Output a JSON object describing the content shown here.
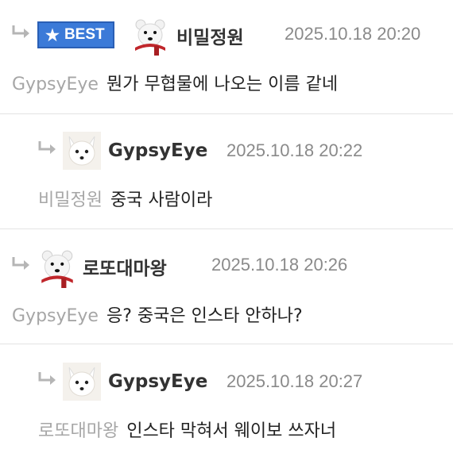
{
  "comments": [
    {
      "best_label": "BEST",
      "nickname": "비밀정원",
      "timestamp": "2025.10.18 20:20",
      "reply_to": "GypsyEye",
      "text": "뭔가 무협물에 나오는 이름 같네",
      "avatar": "polar-bear-icon"
    },
    {
      "nickname": "GypsyEye",
      "timestamp": "2025.10.18 20:22",
      "reply_to": "비밀정원",
      "text": "중국 사람이라",
      "avatar": "arctic-fox-icon"
    },
    {
      "nickname": "로또대마왕",
      "timestamp": "2025.10.18 20:26",
      "reply_to": "GypsyEye",
      "text": "응? 중국은 인스타 안하나?",
      "avatar": "polar-bear-icon"
    },
    {
      "nickname": "GypsyEye",
      "timestamp": "2025.10.18 20:27",
      "reply_to": "로또대마왕",
      "text": "인스타 막혀서 웨이보 쓰자너",
      "avatar": "arctic-fox-icon"
    }
  ],
  "colors": {
    "badge": "#3b7ad8",
    "reply_to": "#a6a6a6",
    "timestamp": "#8a8a8a"
  }
}
